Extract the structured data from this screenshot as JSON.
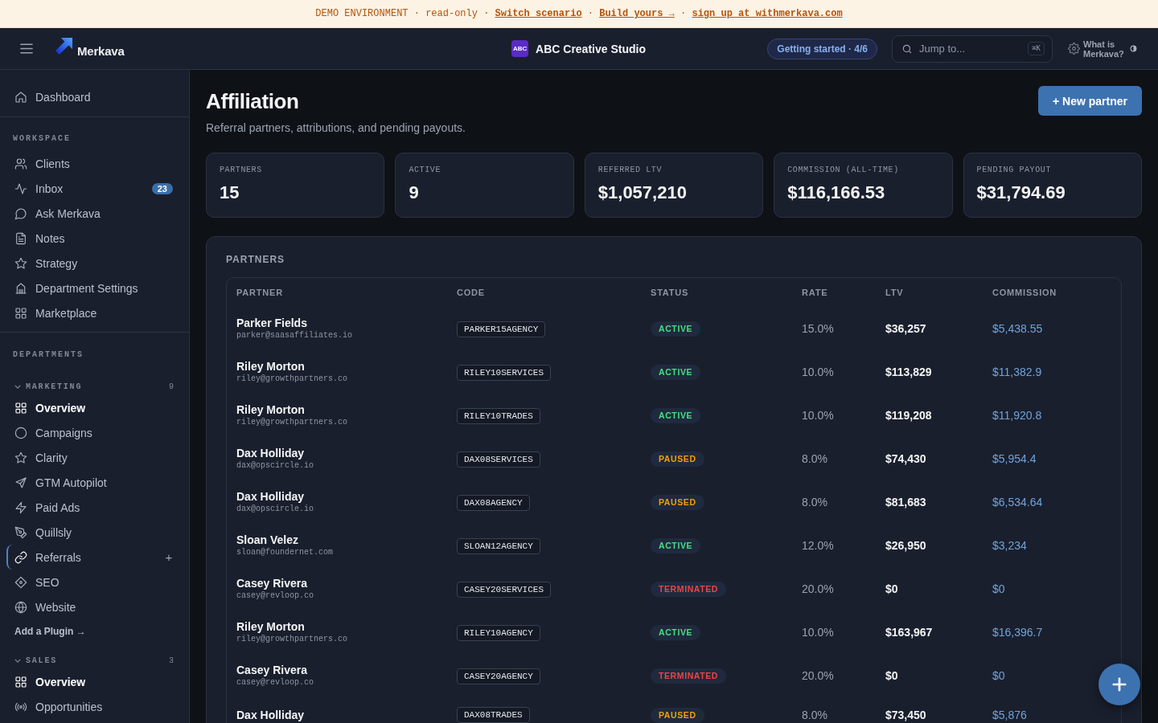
{
  "banner": {
    "parts": [
      {
        "kind": "text",
        "text": "DEMO ENVIRONMENT · read-only · "
      },
      {
        "kind": "link",
        "text": "Switch scenario"
      },
      {
        "kind": "text",
        "text": " · "
      },
      {
        "kind": "link",
        "text": "Build yours →"
      },
      {
        "kind": "text",
        "text": " · "
      },
      {
        "kind": "link",
        "text": "sign up at withmerkava.com"
      }
    ]
  },
  "topbar": {
    "brand": "Merkava",
    "workspace_logo": "ABC",
    "workspace_name": "ABC Creative Studio",
    "progress_button": "Getting started · 4/6",
    "search": {
      "placeholder": "Jump to...",
      "shortcut": "⌘K"
    },
    "help_link": "What is Merkava?"
  },
  "sidebar": {
    "top_items": [
      {
        "label": "Dashboard",
        "selected": false
      }
    ],
    "workspace": {
      "title": "WORKSPACE",
      "items": [
        {
          "label": "Clients",
          "selected": false
        },
        {
          "label": "Inbox",
          "selected": false,
          "badge": "23"
        },
        {
          "label": "Ask Merkava",
          "selected": false
        },
        {
          "label": "Notes",
          "selected": false
        },
        {
          "label": "Strategy",
          "selected": false
        },
        {
          "label": "Department Settings",
          "selected": false
        },
        {
          "label": "Marketplace",
          "selected": false
        }
      ]
    },
    "departments": {
      "title": "DEPARTMENTS",
      "groups": [
        {
          "name": "MARKETING",
          "count": "9",
          "expanded": true,
          "items": [
            {
              "label": "Overview",
              "selected": false,
              "emphasized": true
            },
            {
              "label": "Campaigns",
              "selected": false,
              "emphasized": false
            },
            {
              "label": "Clarity",
              "selected": false,
              "emphasized": false
            },
            {
              "label": "GTM Autopilot",
              "selected": false,
              "emphasized": false
            },
            {
              "label": "Paid Ads",
              "selected": false,
              "emphasized": false
            },
            {
              "label": "Quillsly",
              "selected": false,
              "emphasized": false
            },
            {
              "label": "Referrals",
              "selected": true,
              "emphasized": false,
              "action": "+"
            },
            {
              "label": "SEO",
              "selected": false,
              "emphasized": false
            },
            {
              "label": "Website",
              "selected": false,
              "emphasized": false
            }
          ],
          "footer_link": "Add a Plugin →"
        },
        {
          "name": "SALES",
          "count": "3",
          "expanded": true,
          "items": [
            {
              "label": "Overview",
              "selected": false,
              "emphasized": true
            },
            {
              "label": "Opportunities",
              "selected": false,
              "emphasized": false
            }
          ]
        }
      ]
    }
  },
  "page": {
    "title": "Affiliation",
    "subtitle": "Referral partners, attributions, and pending payouts.",
    "primary_action": "+ New partner"
  },
  "stats": [
    {
      "label": "PARTNERS",
      "value": "15"
    },
    {
      "label": "ACTIVE",
      "value": "9"
    },
    {
      "label": "REFERRED LTV",
      "value": "$1,057,210"
    },
    {
      "label": "COMMISSION (ALL-TIME)",
      "value": "$116,166.53"
    },
    {
      "label": "PENDING PAYOUT",
      "value": "$31,794.69"
    }
  ],
  "partners": {
    "title": "PARTNERS",
    "columns": [
      "PARTNER",
      "CODE",
      "STATUS",
      "RATE",
      "LTV",
      "COMMISSION"
    ],
    "rows": [
      {
        "name": "Parker Fields",
        "email": "parker@saasaffiliates.io",
        "code": "PARKER15AGENCY",
        "status": {
          "label": "ACTIVE",
          "color": "#4ade80"
        },
        "rate": "15.0%",
        "ltv": "$36,257",
        "commission": "$5,438.55"
      },
      {
        "name": "Riley Morton",
        "email": "riley@growthpartners.co",
        "code": "RILEY10SERVICES",
        "status": {
          "label": "ACTIVE",
          "color": "#4ade80"
        },
        "rate": "10.0%",
        "ltv": "$113,829",
        "commission": "$11,382.9"
      },
      {
        "name": "Riley Morton",
        "email": "riley@growthpartners.co",
        "code": "RILEY10TRADES",
        "status": {
          "label": "ACTIVE",
          "color": "#4ade80"
        },
        "rate": "10.0%",
        "ltv": "$119,208",
        "commission": "$11,920.8"
      },
      {
        "name": "Dax Holliday",
        "email": "dax@opscircle.io",
        "code": "DAX08SERVICES",
        "status": {
          "label": "PAUSED",
          "color": "#f59e0b"
        },
        "rate": "8.0%",
        "ltv": "$74,430",
        "commission": "$5,954.4"
      },
      {
        "name": "Dax Holliday",
        "email": "dax@opscircle.io",
        "code": "DAX08AGENCY",
        "status": {
          "label": "PAUSED",
          "color": "#f59e0b"
        },
        "rate": "8.0%",
        "ltv": "$81,683",
        "commission": "$6,534.64"
      },
      {
        "name": "Sloan Velez",
        "email": "sloan@foundernet.com",
        "code": "SLOAN12AGENCY",
        "status": {
          "label": "ACTIVE",
          "color": "#4ade80"
        },
        "rate": "12.0%",
        "ltv": "$26,950",
        "commission": "$3,234"
      },
      {
        "name": "Casey Rivera",
        "email": "casey@revloop.co",
        "code": "CASEY20SERVICES",
        "status": {
          "label": "TERMINATED",
          "color": "#ef4444"
        },
        "rate": "20.0%",
        "ltv": "$0",
        "commission": "$0"
      },
      {
        "name": "Riley Morton",
        "email": "riley@growthpartners.co",
        "code": "RILEY10AGENCY",
        "status": {
          "label": "ACTIVE",
          "color": "#4ade80"
        },
        "rate": "10.0%",
        "ltv": "$163,967",
        "commission": "$16,396.7"
      },
      {
        "name": "Casey Rivera",
        "email": "casey@revloop.co",
        "code": "CASEY20AGENCY",
        "status": {
          "label": "TERMINATED",
          "color": "#ef4444"
        },
        "rate": "20.0%",
        "ltv": "$0",
        "commission": "$0"
      },
      {
        "name": "Dax Holliday",
        "code": "DAX08TRADES",
        "status": {
          "label": "PAUSED",
          "color": "#f59e0b"
        },
        "rate": "8.0%",
        "ltv": "$73,450",
        "commission": "$5,876"
      }
    ]
  }
}
